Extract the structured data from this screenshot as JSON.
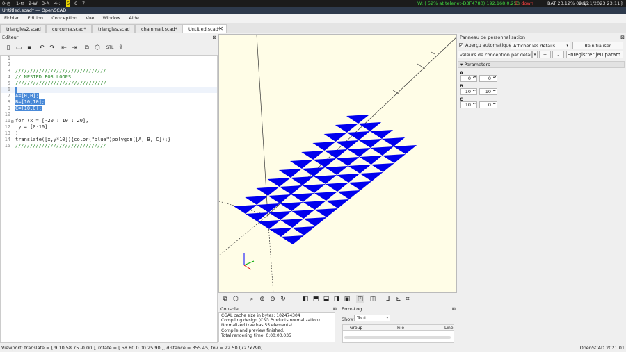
{
  "topbar": {
    "workspaces": [
      "0-◷",
      "1-✉",
      "2-W",
      "3-✎",
      "4-:",
      "5",
      "6",
      "7"
    ],
    "active_index": 5,
    "wifi": "W: ( 52% at telenet-D3F4780) 192.168.0.250",
    "ethernet": "E: down",
    "battery": "BAT 23.12% 02:12",
    "datetime": "06/11/2023 23:11"
  },
  "window": {
    "title": "Untitled.scad* — OpenSCAD"
  },
  "menu": [
    "Fichier",
    "Edition",
    "Conception",
    "Vue",
    "Window",
    "Aide"
  ],
  "tabs": [
    {
      "label": "triangles2.scad"
    },
    {
      "label": "curcuma.scad*"
    },
    {
      "label": "triangles.scad"
    },
    {
      "label": "chainmail.scad*"
    },
    {
      "label": "Untitled.scad*",
      "active": true
    }
  ],
  "editor": {
    "title": "Editeur",
    "toolbar": [
      "new-file",
      "open-file",
      "save",
      "undo",
      "redo",
      "unindent",
      "indent",
      "preview",
      "render",
      "export-stl",
      "send"
    ],
    "lines": [
      "",
      "",
      "///////////////////////////////",
      "// NESTED FOR LOOPS",
      "///////////////////////////////",
      "",
      "A=[0,0];",
      "B=[10,10];",
      "C=[10,0];",
      "",
      "for (x = [-20 : 10 : 20],",
      " y = [0:10]",
      ")",
      "translate([x,y*10]){color(\"blue\")polygon([A, B, C]);}",
      "///////////////////////////////"
    ]
  },
  "console": {
    "title": "Console",
    "lines": [
      "CGAL cache size in bytes: 102474304",
      "Compiling design (CSG Products normalization)...",
      "Normalized tree has 55 elements!",
      "Compile and preview finished.",
      "Total rendering time: 0:00:00.035"
    ]
  },
  "errorlog": {
    "title": "Error-Log",
    "show_label": "Show",
    "show_value": "Tout",
    "columns": [
      "Group",
      "File",
      "Line"
    ]
  },
  "customizer": {
    "title": "Panneau de personnalisation",
    "auto_preview": "Aperçu automatique",
    "details": "Afficher les détails",
    "reset": "Réinitialiser",
    "preset": "valeurs de conception par défaut",
    "plus": "+",
    "minus": "-",
    "save_params": "Enregistrer jeu param.",
    "section": "Parameters",
    "params": [
      {
        "name": "A",
        "values": [
          "0",
          "0"
        ]
      },
      {
        "name": "B",
        "values": [
          "10",
          "10"
        ]
      },
      {
        "name": "C",
        "values": [
          "10",
          "0"
        ]
      }
    ]
  },
  "statusbar": {
    "viewport": "Viewport: translate = [ 9.10 58.75 -0.00 ], rotate = [ 58.80 0.00 25.90 ], distance = 355.45, fov = 22.50 (727x790)",
    "version": "OpenSCAD 2021.01"
  },
  "colors": {
    "model": "#0000ee",
    "viewport_bg": "#fffde7",
    "selection": "#4a8ad8"
  }
}
